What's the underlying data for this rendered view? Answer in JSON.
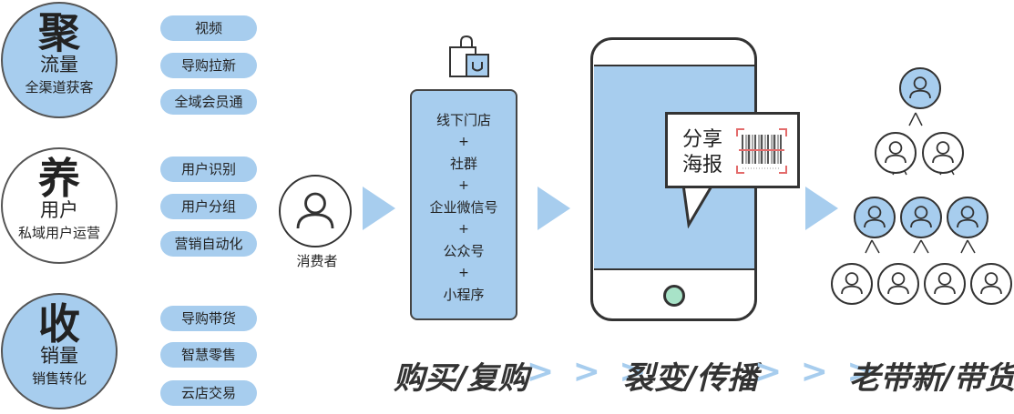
{
  "stages": [
    {
      "big": "聚",
      "mid": "流量",
      "small": "全渠道获客",
      "style": "blue",
      "items": [
        "视频",
        "导购拉新",
        "全域会员通"
      ]
    },
    {
      "big": "养",
      "mid": "用户",
      "small": "私域用户运营",
      "style": "white",
      "items": [
        "用户识别",
        "用户分组",
        "营销自动化"
      ]
    },
    {
      "big": "收",
      "mid": "销量",
      "small": "销售转化",
      "style": "blue",
      "items": [
        "导购带货",
        "智慧零售",
        "云店交易"
      ]
    }
  ],
  "consumer": {
    "label": "消费者"
  },
  "channels": {
    "items": [
      "线下门店",
      "社群",
      "企业微信号",
      "公众号",
      "小程序"
    ],
    "separator": "+"
  },
  "poster": {
    "text": "分享海报"
  },
  "flow": {
    "step1": "购买/复购",
    "step2": "裂变/传播",
    "step3": "老带新/带货",
    "chevrons": "> > >"
  },
  "colors": {
    "accent": "#a7cdee",
    "outline": "#333333",
    "phone_button": "#a8e3c8"
  },
  "icons": {
    "consumer": "person-icon",
    "bag": "shopping-bag-icon",
    "barcode": "barcode-icon"
  }
}
